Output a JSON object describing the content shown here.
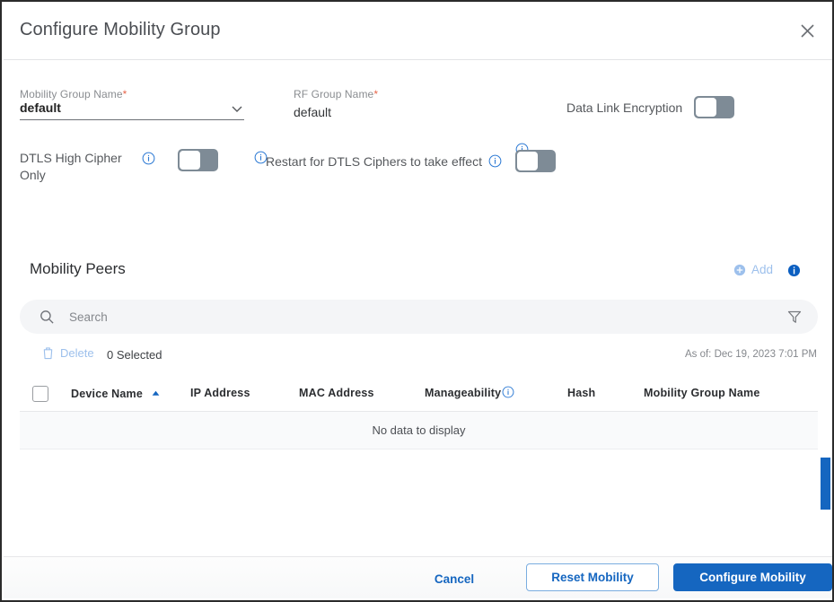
{
  "dialog": {
    "title": "Configure Mobility Group",
    "close_icon": "close-icon"
  },
  "form": {
    "mobility_group_name": {
      "label": "Mobility Group Name",
      "required_marker": "*",
      "value": "default",
      "info_icon": "info-circle-icon",
      "chevron_icon": "chevron-down-icon"
    },
    "rf_group_name": {
      "label": "RF Group Name",
      "required_marker": "*",
      "value": "default",
      "info_icon": "info-circle-icon"
    },
    "data_link_encryption": {
      "label": "Data Link Encryption",
      "state": "off"
    },
    "dtls_high_cipher_only": {
      "label": "DTLS High Cipher Only",
      "info_icon": "info-circle-icon",
      "state": "off"
    },
    "restart_for_dtls": {
      "label": "Restart for DTLS Ciphers to take effect",
      "info_icon": "info-circle-icon",
      "state": "off"
    }
  },
  "peers": {
    "title": "Mobility Peers",
    "add_label": "Add",
    "add_icon": "plus-circle-icon",
    "info_icon": "info-circle-filled-icon",
    "search": {
      "placeholder": "Search",
      "value": "",
      "icon": "search-icon"
    },
    "filter_icon": "filter-funnel-icon",
    "delete_label": "Delete",
    "delete_icon": "trash-icon",
    "selected_count_label": "0 Selected",
    "as_of": "As of: Dec 19, 2023 7:01 PM",
    "columns": [
      {
        "label": "Device Name",
        "sorted": "asc",
        "sort_icon": "sort-asc-icon"
      },
      {
        "label": "IP Address"
      },
      {
        "label": "MAC Address"
      },
      {
        "label": "Manageability",
        "info_icon": "info-circle-icon"
      },
      {
        "label": "Hash"
      },
      {
        "label": "Mobility Group Name"
      }
    ],
    "empty_message": "No data to display"
  },
  "footer": {
    "cancel_label": "Cancel",
    "reset_label": "Reset Mobility",
    "configure_label": "Configure Mobility"
  },
  "colors": {
    "accent_blue": "#1566c0",
    "toggle_track": "#7e8b96",
    "disabled_blue": "#9dc0ec",
    "required_red": "#e8664b"
  }
}
